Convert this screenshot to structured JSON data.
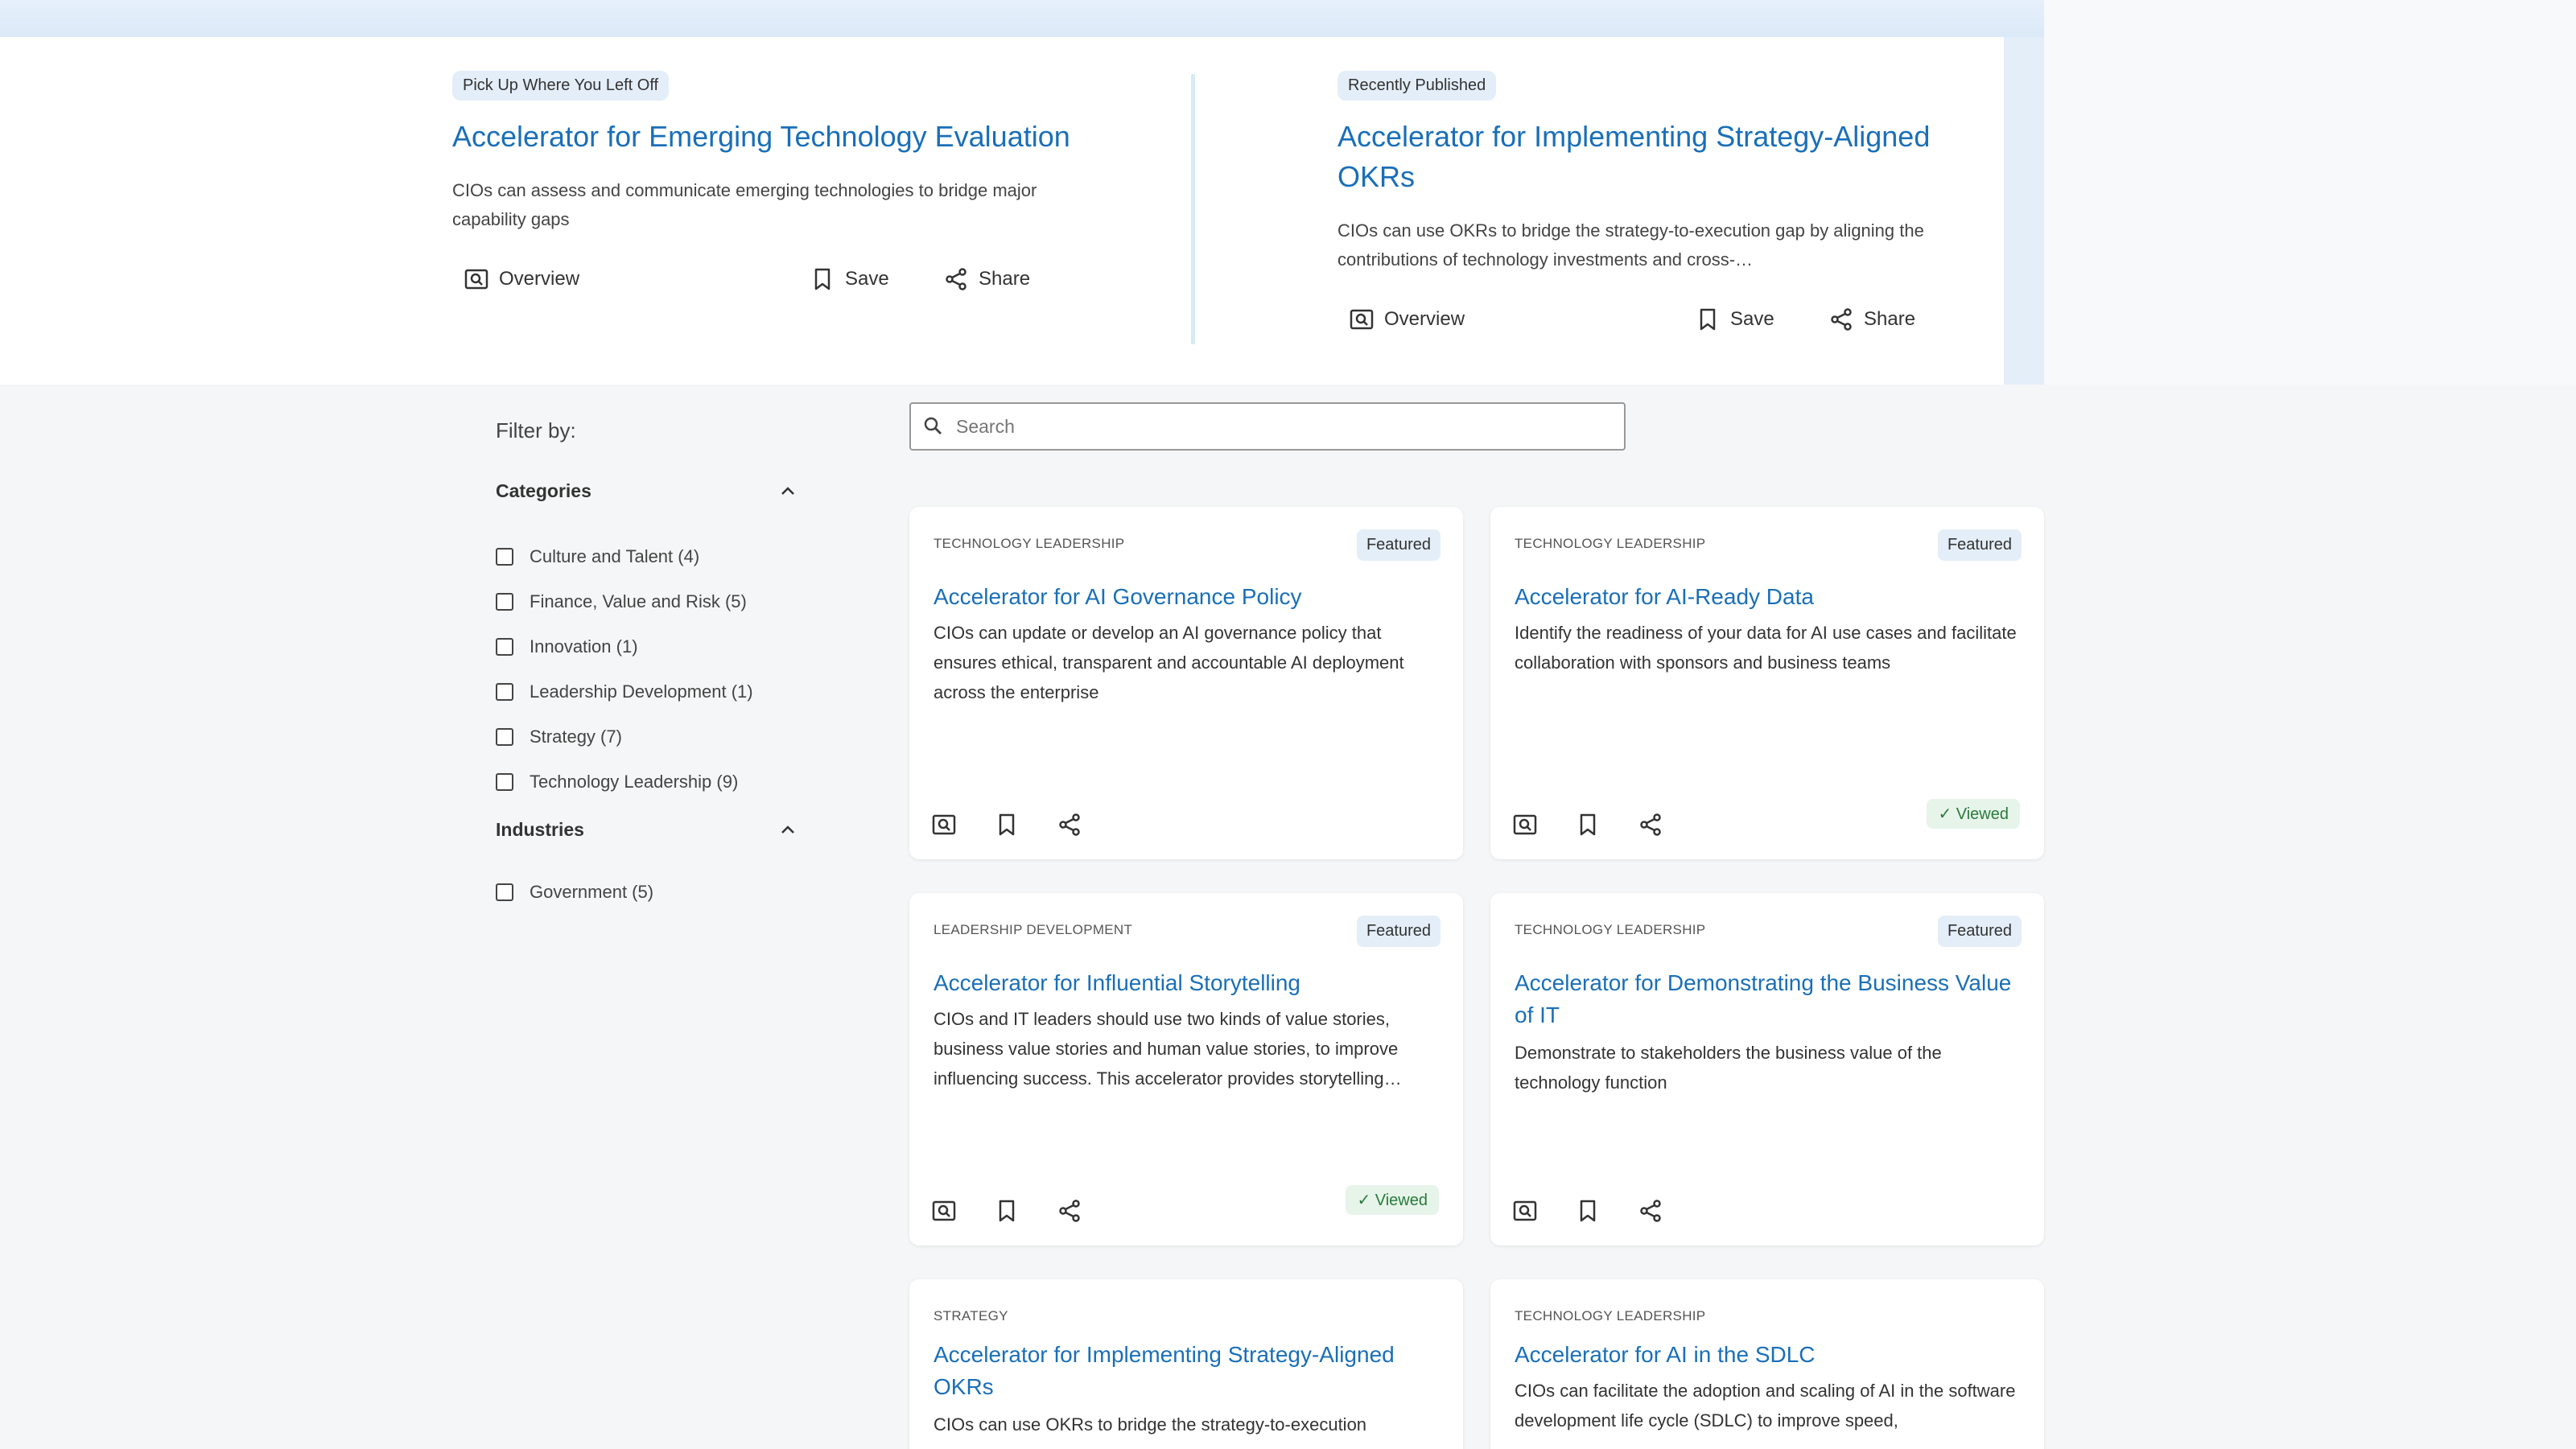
{
  "hero": {
    "items": [
      {
        "pill": "Pick Up Where You Left Off",
        "title": "Accelerator for Emerging Technology Evaluation",
        "description": "CIOs can assess and communicate emerging technologies to bridge major capability gaps",
        "overview": "Overview",
        "save": "Save",
        "share": "Share"
      },
      {
        "pill": "Recently Published",
        "title": "Accelerator for Implementing Strategy-Aligned OKRs",
        "description": "CIOs can use OKRs to bridge the strategy-to-execution gap by aligning the contributions of technology investments and cross-…",
        "overview": "Overview",
        "save": "Save",
        "share": "Share"
      }
    ]
  },
  "filter": {
    "title": "Filter by:",
    "categories": {
      "label": "Categories",
      "items": [
        "Culture and Talent (4)",
        "Finance, Value and Risk (5)",
        "Innovation (1)",
        "Leadership Development (1)",
        "Strategy (7)",
        "Technology Leadership (9)"
      ]
    },
    "industries": {
      "label": "Industries",
      "items": [
        "Government (5)"
      ]
    }
  },
  "search": {
    "placeholder": "Search"
  },
  "cards": [
    {
      "category": "TECHNOLOGY LEADERSHIP",
      "badge": "Featured",
      "title": "Accelerator for AI Governance Policy",
      "description": "CIOs can update or develop an AI governance policy that ensures ethical, transparent and accountable AI deployment across the enterprise",
      "viewed": ""
    },
    {
      "category": "TECHNOLOGY LEADERSHIP",
      "badge": "Featured",
      "title": "Accelerator for AI-Ready Data",
      "description": "Identify the readiness of your data for AI use cases and facilitate collaboration with sponsors and business teams",
      "viewed": "✓ Viewed"
    },
    {
      "category": "LEADERSHIP DEVELOPMENT",
      "badge": "Featured",
      "title": "Accelerator for Influential Storytelling",
      "description": "CIOs and IT leaders should use two kinds of value stories, business value stories and human value stories, to improve influencing success. This accelerator provides storytelling…",
      "viewed": "✓ Viewed"
    },
    {
      "category": "TECHNOLOGY LEADERSHIP",
      "badge": "Featured",
      "title": "Accelerator for Demonstrating the Business Value of IT",
      "description": "Demonstrate to stakeholders the business value of the technology function",
      "viewed": ""
    },
    {
      "category": "STRATEGY",
      "badge": "",
      "title": "Accelerator for Implementing Strategy-Aligned OKRs",
      "description": "CIOs can use OKRs to bridge the strategy-to-execution",
      "viewed": ""
    },
    {
      "category": "TECHNOLOGY LEADERSHIP",
      "badge": "",
      "title": "Accelerator for AI in the SDLC",
      "description": "CIOs can facilitate the adoption and scaling of AI in the software development life cycle (SDLC) to improve speed,",
      "viewed": ""
    }
  ]
}
